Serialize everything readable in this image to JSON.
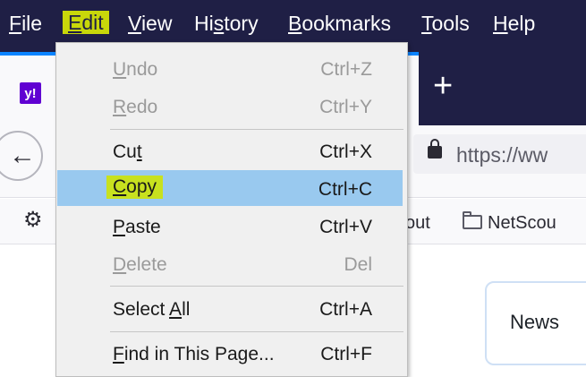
{
  "menubar": {
    "items": [
      {
        "key": "F",
        "rest": "ile"
      },
      {
        "key": "E",
        "rest": "dit"
      },
      {
        "key": "V",
        "rest": "iew"
      },
      {
        "pre": "Hi",
        "key": "s",
        "rest": "tory"
      },
      {
        "key": "B",
        "rest": "ookmarks"
      },
      {
        "key": "T",
        "rest": "ools"
      },
      {
        "key": "H",
        "rest": "elp"
      }
    ]
  },
  "tabs": {
    "favicon_text": "y!",
    "new_tab_symbol": "+"
  },
  "navbar": {
    "back_symbol": "←",
    "url": "https://ww"
  },
  "bookmarks": {
    "item1": "out",
    "item2": "NetScou"
  },
  "page": {
    "news_label": "News"
  },
  "edit_menu": {
    "items": [
      {
        "pre": "",
        "key": "U",
        "rest": "ndo",
        "shortcut": "Ctrl+Z",
        "state": "disabled"
      },
      {
        "pre": "",
        "key": "R",
        "rest": "edo",
        "shortcut": "Ctrl+Y",
        "state": "disabled"
      },
      {
        "pre": "Cu",
        "key": "t",
        "rest": "",
        "shortcut": "Ctrl+X",
        "state": "enabled"
      },
      {
        "pre": "",
        "key": "C",
        "rest": "opy",
        "shortcut": "Ctrl+C",
        "state": "selected"
      },
      {
        "pre": "",
        "key": "P",
        "rest": "aste",
        "shortcut": "Ctrl+V",
        "state": "enabled"
      },
      {
        "pre": "",
        "key": "D",
        "rest": "elete",
        "shortcut": "Del",
        "state": "disabled"
      },
      {
        "pre": "Select ",
        "key": "A",
        "rest": "ll",
        "shortcut": "Ctrl+A",
        "state": "enabled"
      },
      {
        "pre": "",
        "key": "F",
        "rest": "ind in This Page...",
        "shortcut": "Ctrl+F",
        "state": "enabled"
      }
    ]
  },
  "colors": {
    "menubar_bg": "#1f1f45",
    "edit_highlight": "#c8d70a",
    "selected_row": "#99c9ef",
    "copy_highlight": "#c8e11f",
    "menu_bg": "#f0f0f0"
  }
}
